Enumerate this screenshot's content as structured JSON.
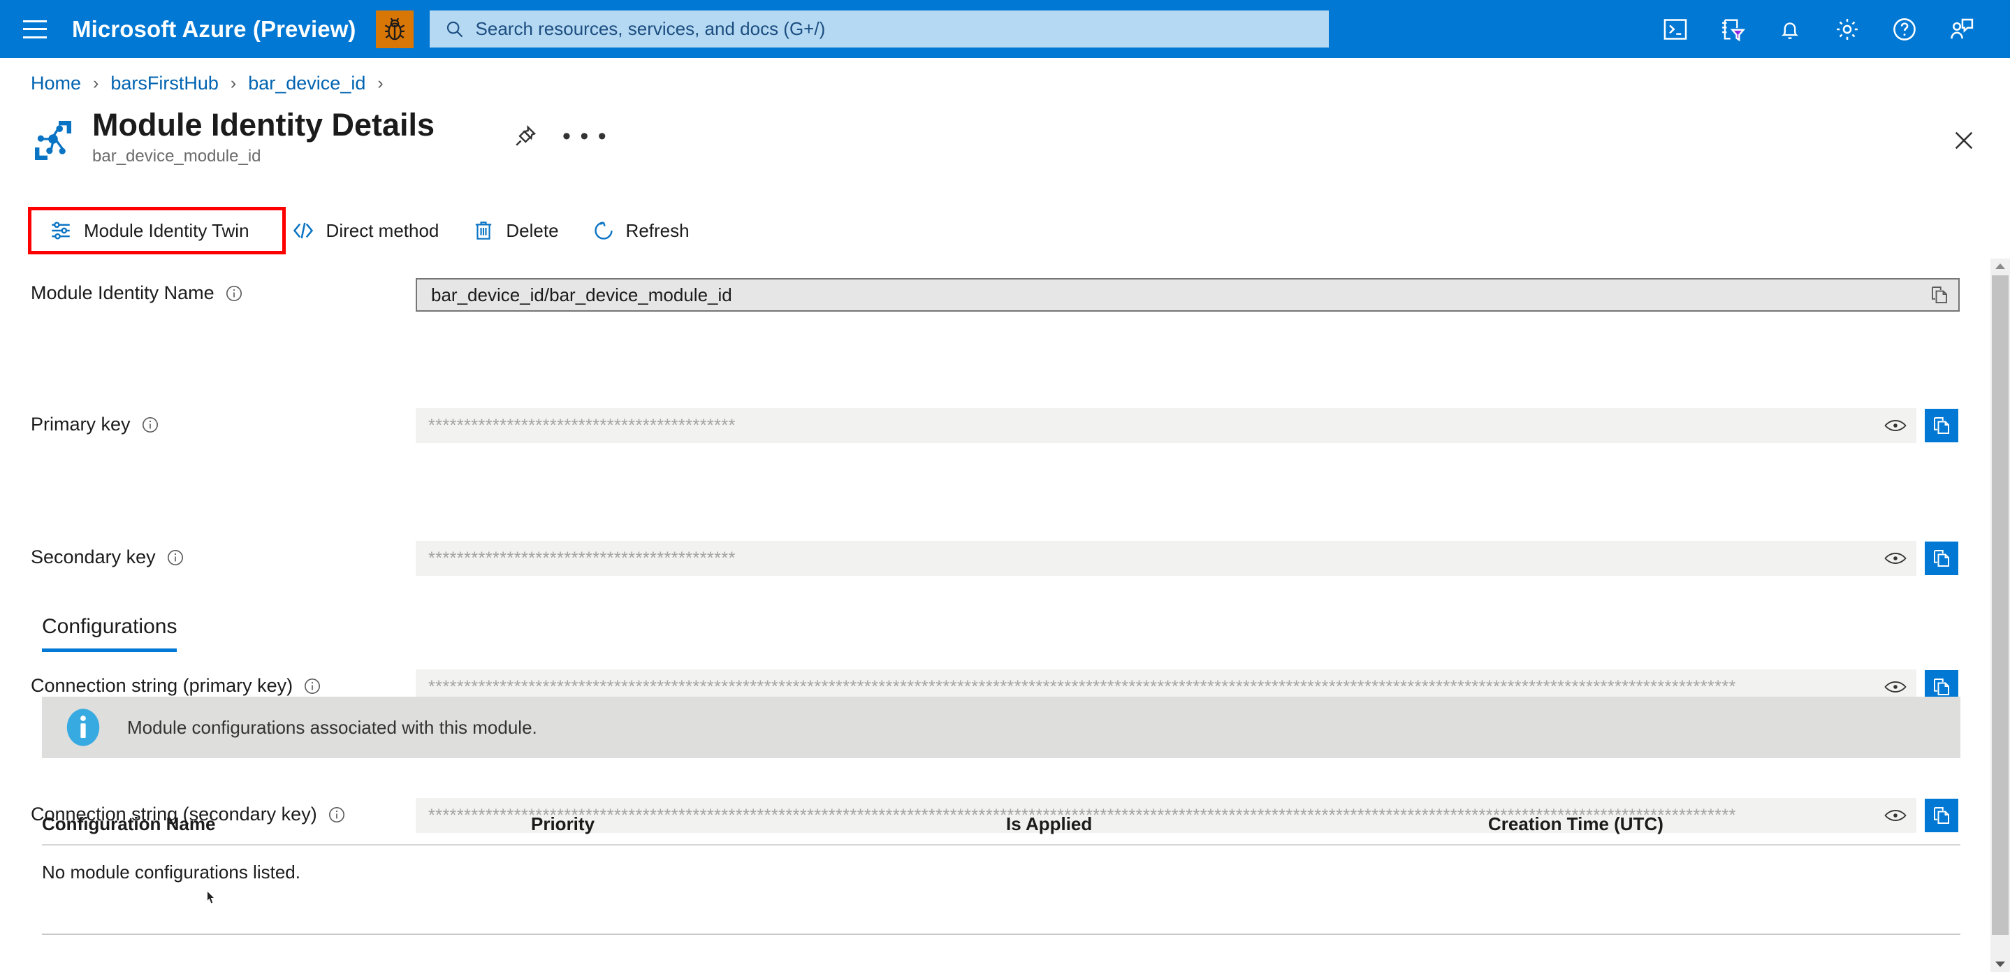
{
  "topbar": {
    "menu_icon": "hamburger-icon",
    "brand": "Microsoft Azure (Preview)",
    "bug_icon": "bug-icon",
    "brand_color": "#0078d4",
    "bug_color": "#d97706",
    "search": {
      "icon": "search-icon",
      "placeholder": "Search resources, services, and docs (G+/)",
      "value": ""
    },
    "icons": [
      {
        "name": "cloud-shell-icon",
        "label": "Cloud Shell"
      },
      {
        "name": "directories-filter-icon",
        "label": "Directories + subscriptions"
      },
      {
        "name": "notifications-bell-icon",
        "label": "Notifications"
      },
      {
        "name": "settings-gear-icon",
        "label": "Settings"
      },
      {
        "name": "help-question-icon",
        "label": "Help"
      },
      {
        "name": "feedback-person-icon",
        "label": "Feedback"
      }
    ]
  },
  "breadcrumb": {
    "items": [
      "Home",
      "barsFirstHub",
      "bar_device_id"
    ],
    "separator": "›"
  },
  "header": {
    "icon": "module-identity-icon",
    "title": "Module Identity Details",
    "subtitle": "bar_device_module_id",
    "pin_icon": "pin-icon",
    "more_icon": "ellipsis-icon",
    "more_glyph": "• • •",
    "close_icon": "close-icon"
  },
  "commandbar": {
    "highlight_color": "#ff0000",
    "commands": [
      {
        "icon": "module-identity-twin-icon",
        "label": "Module Identity Twin",
        "highlighted": true
      },
      {
        "icon": "direct-method-icon",
        "label": "Direct method",
        "highlighted": false
      },
      {
        "icon": "delete-trash-icon",
        "label": "Delete",
        "highlighted": false
      },
      {
        "icon": "refresh-icon",
        "label": "Refresh",
        "highlighted": false
      }
    ]
  },
  "form": {
    "fields": [
      {
        "label": "Module Identity Name",
        "info_icon": "info-icon",
        "value": "bar_device_id/bar_device_module_id",
        "style": "outlined",
        "has_eye": false,
        "copy_icon": "copy-icon"
      },
      {
        "label": "Primary key",
        "info_icon": "info-icon",
        "value": "*******************************************",
        "style": "flat",
        "has_eye": true,
        "eye_icon": "eye-icon",
        "copy_icon": "copy-icon"
      },
      {
        "label": "Secondary key",
        "info_icon": "info-icon",
        "value": "*******************************************",
        "style": "flat",
        "has_eye": true,
        "eye_icon": "eye-icon",
        "copy_icon": "copy-icon"
      },
      {
        "label": "Connection string (primary key)",
        "info_icon": "info-icon",
        "value": "***************************************************************************************************************************************************************************************",
        "style": "flat",
        "has_eye": true,
        "eye_icon": "eye-icon",
        "copy_icon": "copy-icon"
      },
      {
        "label": "Connection string (secondary key)",
        "info_icon": "info-icon",
        "value": "***************************************************************************************************************************************************************************************",
        "style": "flat",
        "has_eye": true,
        "eye_icon": "eye-icon",
        "copy_icon": "copy-icon"
      }
    ]
  },
  "tabs": [
    {
      "label": "Configurations",
      "active": true
    }
  ],
  "banner": {
    "icon": "info-circle-icon",
    "text": "Module configurations associated with this module.",
    "background": "#dededc",
    "icon_color": "#37aae1"
  },
  "table": {
    "columns": [
      "Configuration Name",
      "Priority",
      "Is Applied",
      "Creation Time (UTC)"
    ],
    "empty_message": "No module configurations listed.",
    "rows": []
  },
  "scrollbar": {
    "name": "vertical-scrollbar",
    "up_arrow": "chevron-up-icon",
    "down_arrow": "chevron-down-icon"
  }
}
